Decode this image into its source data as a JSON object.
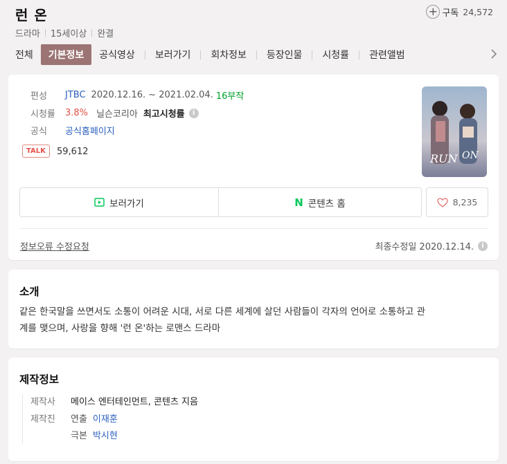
{
  "header": {
    "title": "런 온",
    "meta": [
      "드라마",
      "15세이상",
      "완결"
    ],
    "subscribe_label": "구독",
    "subscribe_count": "24,572"
  },
  "tabs": [
    {
      "label": "전체"
    },
    {
      "label": "기본정보",
      "active": true
    },
    {
      "label": "공식영상"
    },
    {
      "label": "보러가기"
    },
    {
      "label": "회차정보"
    },
    {
      "label": "등장인물"
    },
    {
      "label": "시청률"
    },
    {
      "label": "관련앨범"
    }
  ],
  "info": {
    "broadcast_label": "편성",
    "channel": "JTBC",
    "period": "2020.12.16. ~ 2021.02.04.",
    "episodes": "16부작",
    "rating_label": "시청률",
    "rating_value": "3.8%",
    "rating_source": "닐슨코리아",
    "rating_max": "최고시청률",
    "official_label": "공식",
    "official_link": "공식홈페이지",
    "talk_badge": "TALK",
    "talk_count": "59,612",
    "watch_button": "보러가기",
    "home_button": "콘텐츠 홈",
    "n_logo": "N",
    "like_count": "8,235",
    "report_link": "정보오류 수정요청",
    "last_modified": "최종수정일 2020.12.14."
  },
  "intro": {
    "title": "소개",
    "line1": "같은 한국말을 쓰면서도 소통이 어려운 시대, 서로 다른 세계에 살던 사람들이 각자의 언어로 소통하고 관",
    "line2": "계를 맺으며, 사랑을 향해 '런 온'하는 로맨스 드라마"
  },
  "production": {
    "title": "제작정보",
    "company_label": "제작사",
    "companies": "메이스 엔터테인먼트, 콘텐츠 지음",
    "staff_label": "제작진",
    "director_role": "연출",
    "director": "이재훈",
    "writer_role": "극본",
    "writer": "박시현"
  },
  "colors": {
    "accent": "#9b7473",
    "link": "#2b5fbe",
    "rating": "#e5514b",
    "episodes": "#00a22a",
    "naver_green": "#03c75a"
  },
  "icons": [
    "plus-icon",
    "chevron-right-icon",
    "info-icon",
    "play-icon",
    "heart-icon"
  ]
}
